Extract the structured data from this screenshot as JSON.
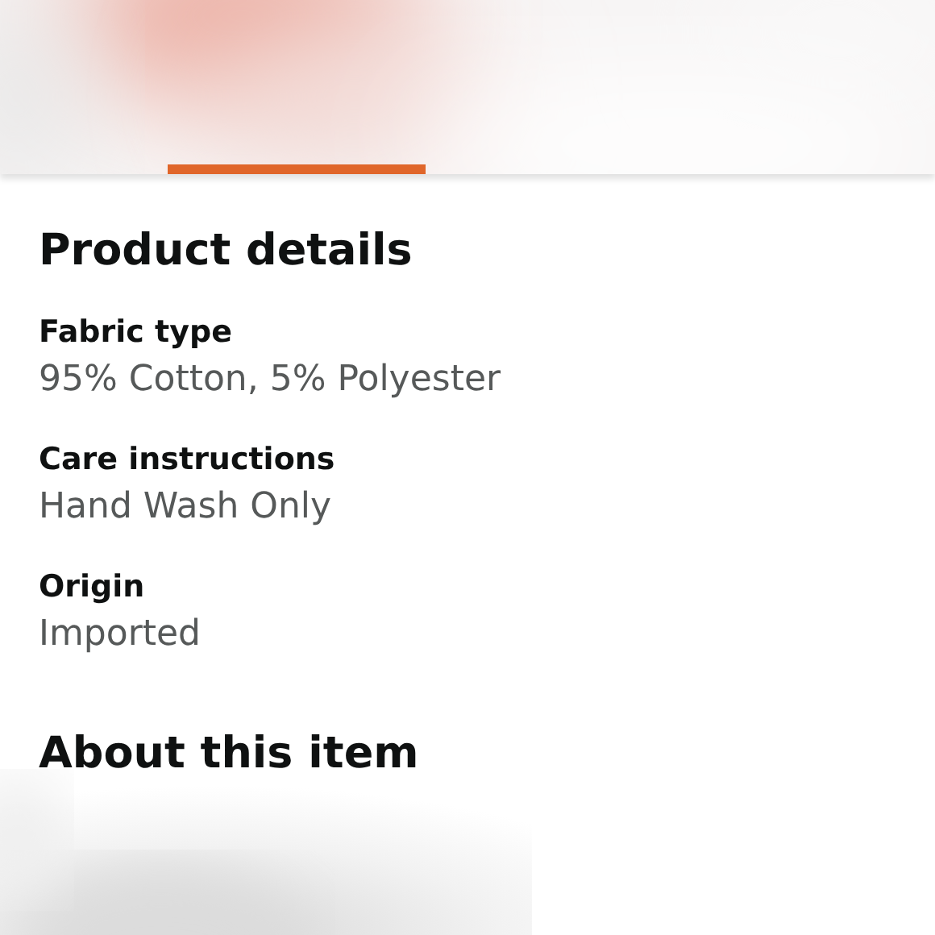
{
  "section_title": "Product details",
  "details": [
    {
      "label": "Fabric type",
      "value": "95% Cotton, 5% Polyester"
    },
    {
      "label": "Care instructions",
      "value": "Hand Wash Only"
    },
    {
      "label": "Origin",
      "value": "Imported"
    }
  ],
  "next_section_title": "About this item"
}
